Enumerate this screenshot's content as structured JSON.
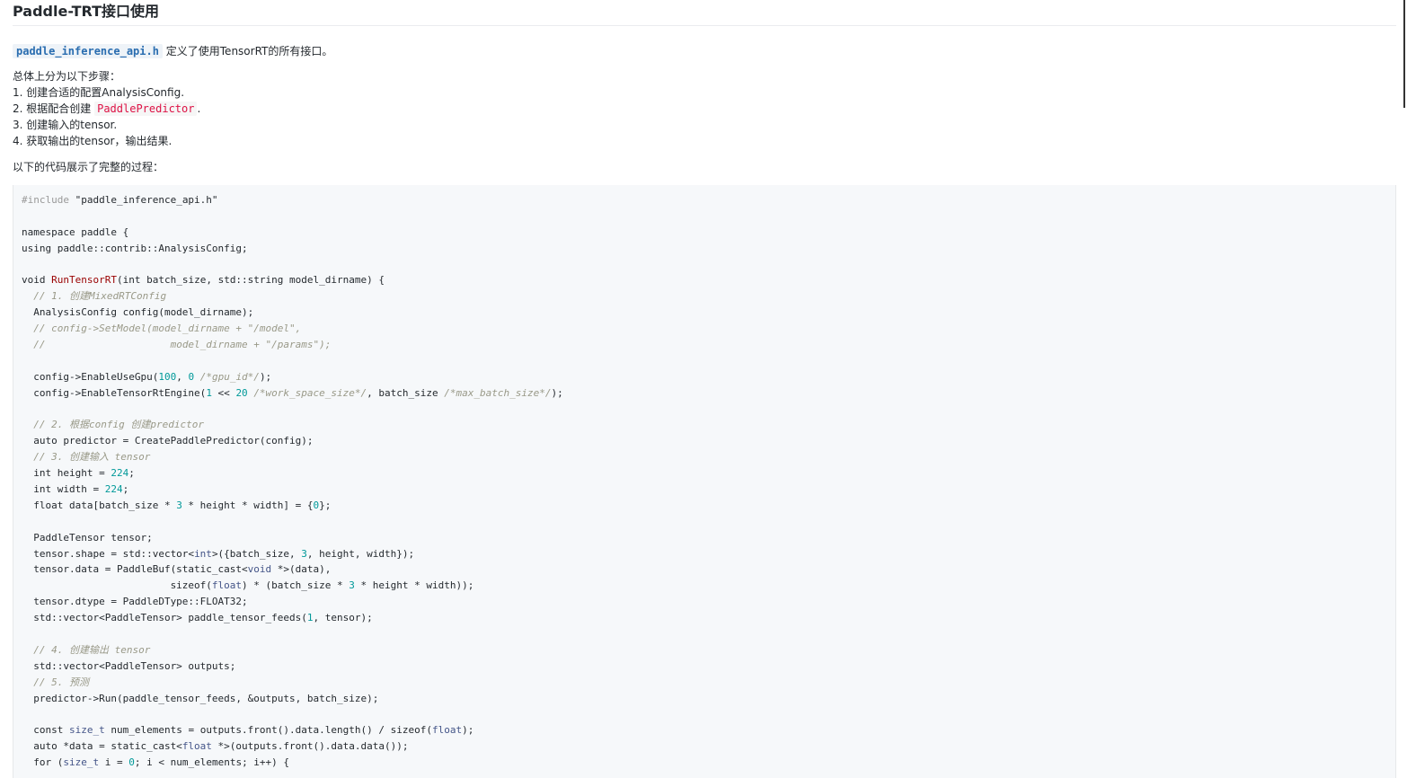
{
  "page": {
    "title": "Paddle-TRT接口使用",
    "intro": {
      "api_file": "paddle_inference_api.h",
      "api_desc": " 定义了使用TensorRT的所有接口。"
    },
    "steps_heading": "总体上分为以下步骤：",
    "steps": [
      {
        "text": "1. 创建合适的配置AnalysisConfig."
      },
      {
        "text": "2. 根据配合创建 ",
        "code": "PaddlePredictor",
        "after": "."
      },
      {
        "text": "3. 创建输入的tensor."
      },
      {
        "text": "4. 获取输出的tensor，输出结果."
      }
    ],
    "code_intro": "以下的代码展示了完整的过程："
  },
  "code_lines": [
    [
      {
        "t": "#include",
        "c": "pre"
      },
      {
        "t": " \"paddle_inference_api.h\""
      }
    ],
    [],
    [
      {
        "t": "namespace paddle {"
      }
    ],
    [
      {
        "t": "using paddle::contrib::AnalysisConfig;"
      }
    ],
    [],
    [
      {
        "t": "void "
      },
      {
        "t": "RunTensorRT",
        "c": "fn"
      },
      {
        "t": "(int batch_size, std::string model_dirname) {"
      }
    ],
    [
      {
        "t": "  "
      },
      {
        "t": "// 1. 创建MixedRTConfig",
        "c": "com"
      }
    ],
    [
      {
        "t": "  AnalysisConfig config(model_dirname);"
      }
    ],
    [
      {
        "t": "  "
      },
      {
        "t": "// config->SetModel(model_dirname + \"/model\",",
        "c": "com"
      }
    ],
    [
      {
        "t": "  "
      },
      {
        "t": "//                     model_dirname + \"/params\");",
        "c": "com"
      }
    ],
    [],
    [
      {
        "t": "  config->EnableUseGpu("
      },
      {
        "t": "100",
        "c": "num"
      },
      {
        "t": ", "
      },
      {
        "t": "0",
        "c": "num"
      },
      {
        "t": " "
      },
      {
        "t": "/*gpu_id*/",
        "c": "com"
      },
      {
        "t": ");"
      }
    ],
    [
      {
        "t": "  config->EnableTensorRtEngine("
      },
      {
        "t": "1",
        "c": "num"
      },
      {
        "t": " << "
      },
      {
        "t": "20",
        "c": "num"
      },
      {
        "t": " "
      },
      {
        "t": "/*work_space_size*/",
        "c": "com"
      },
      {
        "t": ", batch_size "
      },
      {
        "t": "/*max_batch_size*/",
        "c": "com"
      },
      {
        "t": ");"
      }
    ],
    [],
    [
      {
        "t": "  "
      },
      {
        "t": "// 2. 根据config 创建predictor",
        "c": "com"
      }
    ],
    [
      {
        "t": "  auto predictor = CreatePaddlePredictor(config);"
      }
    ],
    [
      {
        "t": "  "
      },
      {
        "t": "// 3. 创建输入 tensor",
        "c": "com"
      }
    ],
    [
      {
        "t": "  int height = "
      },
      {
        "t": "224",
        "c": "num"
      },
      {
        "t": ";"
      }
    ],
    [
      {
        "t": "  int width = "
      },
      {
        "t": "224",
        "c": "num"
      },
      {
        "t": ";"
      }
    ],
    [
      {
        "t": "  float data[batch_size * "
      },
      {
        "t": "3",
        "c": "num"
      },
      {
        "t": " * height * width] = {"
      },
      {
        "t": "0",
        "c": "num"
      },
      {
        "t": "};"
      }
    ],
    [],
    [
      {
        "t": "  PaddleTensor tensor;"
      }
    ],
    [
      {
        "t": "  tensor.shape = std::vector<"
      },
      {
        "t": "int",
        "c": "type"
      },
      {
        "t": ">({batch_size, "
      },
      {
        "t": "3",
        "c": "num"
      },
      {
        "t": ", height, width});"
      }
    ],
    [
      {
        "t": "  tensor.data = PaddleBuf(static_cast<"
      },
      {
        "t": "void",
        "c": "type"
      },
      {
        "t": " *>(data),"
      }
    ],
    [
      {
        "t": "                         sizeof("
      },
      {
        "t": "float",
        "c": "type"
      },
      {
        "t": ") * (batch_size * "
      },
      {
        "t": "3",
        "c": "num"
      },
      {
        "t": " * height * width));"
      }
    ],
    [
      {
        "t": "  tensor.dtype = PaddleDType::FLOAT32;"
      }
    ],
    [
      {
        "t": "  std::vector<PaddleTensor> paddle_tensor_feeds("
      },
      {
        "t": "1",
        "c": "num"
      },
      {
        "t": ", tensor);"
      }
    ],
    [],
    [
      {
        "t": "  "
      },
      {
        "t": "// 4. 创建输出 tensor",
        "c": "com"
      }
    ],
    [
      {
        "t": "  std::vector<PaddleTensor> outputs;"
      }
    ],
    [
      {
        "t": "  "
      },
      {
        "t": "// 5. 预测",
        "c": "com"
      }
    ],
    [
      {
        "t": "  predictor->Run(paddle_tensor_feeds, &outputs, batch_size);"
      }
    ],
    [],
    [
      {
        "t": "  const "
      },
      {
        "t": "size_t",
        "c": "type"
      },
      {
        "t": " num_elements = outputs.front().data.length() / sizeof("
      },
      {
        "t": "float",
        "c": "type"
      },
      {
        "t": ");"
      }
    ],
    [
      {
        "t": "  auto *data = static_cast<"
      },
      {
        "t": "float",
        "c": "type"
      },
      {
        "t": " *>(outputs.front().data.data());"
      }
    ],
    [
      {
        "t": "  for ("
      },
      {
        "t": "size_t",
        "c": "type"
      },
      {
        "t": " i = "
      },
      {
        "t": "0",
        "c": "num"
      },
      {
        "t": "; i < num_elements; i++) {"
      }
    ]
  ]
}
